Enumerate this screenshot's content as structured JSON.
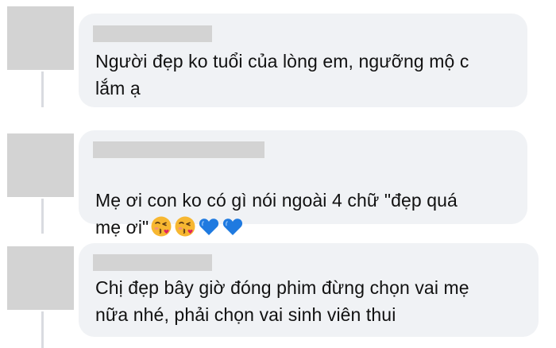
{
  "comments": [
    {
      "text": "Người đẹp ko tuổi của lòng em, ngưỡng mộ c\nlắm ạ",
      "emojis": []
    },
    {
      "text": "Mẹ ơi con ko có gì nói ngoài 4 chữ \"đẹp quá\nmẹ ơi\"",
      "emojis": [
        "face-blowing-kiss-icon",
        "face-blowing-kiss-icon",
        "blue-heart-icon",
        "blue-heart-icon"
      ]
    },
    {
      "text": "Chị đẹp bây giờ đóng phim đừng chọn vai mẹ\nnữa nhé, phải chọn vai sinh viên thui",
      "emojis": []
    }
  ],
  "colors": {
    "bubble": "#f0f2f5",
    "placeholder": "#d3d3d3",
    "text": "#111111",
    "thread_line": "#d9dbe0"
  }
}
